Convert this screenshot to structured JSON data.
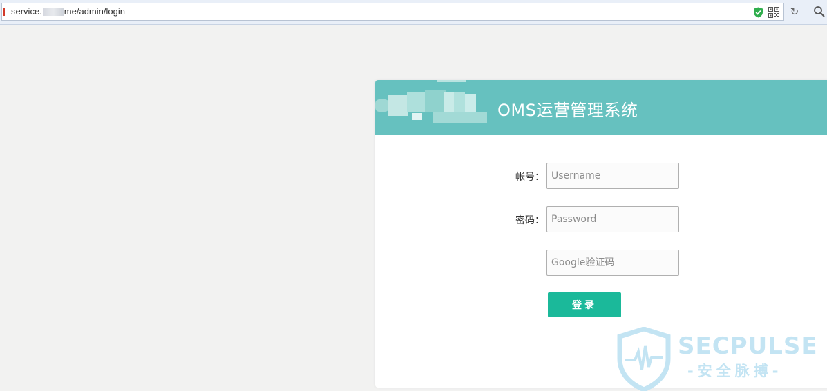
{
  "browser": {
    "url_prefix": "service.",
    "url_suffix": "me/admin/login"
  },
  "header": {
    "title": "OMS运营管理系统"
  },
  "form": {
    "username_label": "帐号：",
    "username_placeholder": "Username",
    "password_label": "密码：",
    "password_placeholder": "Password",
    "captcha_placeholder": "Google验证码",
    "login_label": "登录"
  },
  "watermark": {
    "title": "SECPULSE",
    "subtitle": "-安全脉搏-"
  },
  "colors": {
    "header_bg": "#66c1bf",
    "button_bg": "#1bb99a",
    "watermark": "#c3e4f3"
  },
  "icons": [
    "shield-check-icon",
    "qr-code-icon",
    "refresh-icon",
    "search-icon"
  ]
}
